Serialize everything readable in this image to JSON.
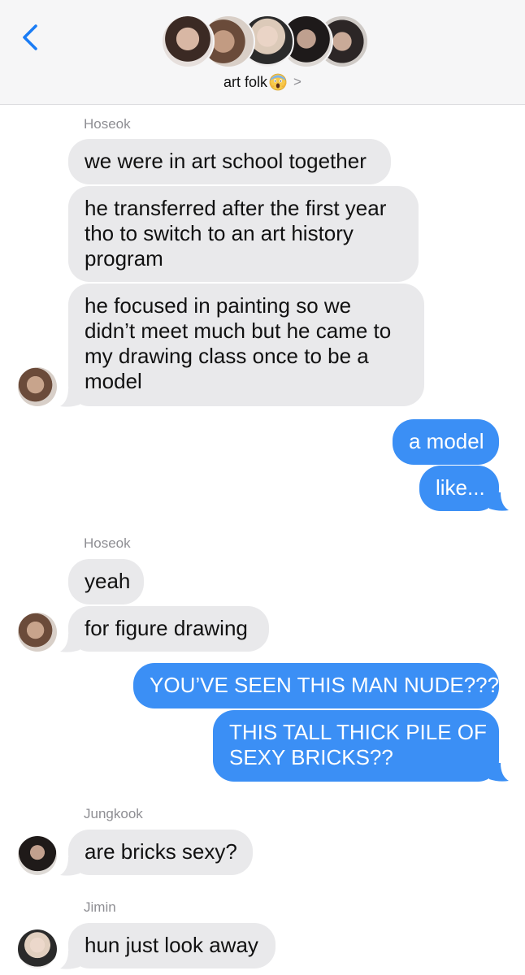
{
  "header": {
    "title": "art folk",
    "title_emoji": "screaming-face-emoji",
    "back_icon": "chevron-left-icon",
    "disclosure": ">"
  },
  "messages": {
    "sender_1": "Hoseok",
    "m1": "we were in art school together",
    "m2_l1": "he transferred after the first year",
    "m2_l2": "tho to switch to an art history",
    "m2_l3": "program",
    "m3_l1": "he focused in painting so we",
    "m3_l2": "didn’t meet much but he came to",
    "m3_l3": "my drawing class once to be a",
    "m3_l4": "model",
    "s1": "a model",
    "s2": "like...",
    "sender_2": "Hoseok",
    "m4": "yeah",
    "m5": "for figure drawing",
    "s3": "YOU’VE SEEN THIS MAN NUDE???",
    "s4_l1": "THIS TALL THICK PILE OF",
    "s4_l2": "SEXY BRICKS??",
    "sender_3": "Jungkook",
    "m6": "are bricks sexy?",
    "sender_4": "Jimin",
    "m7": "hun just look away"
  },
  "colors": {
    "sent_bubble": "#3b8ff5",
    "received_bubble": "#e9e9eb",
    "accent": "#1a7cf5",
    "meta_text": "#8e8e93"
  }
}
